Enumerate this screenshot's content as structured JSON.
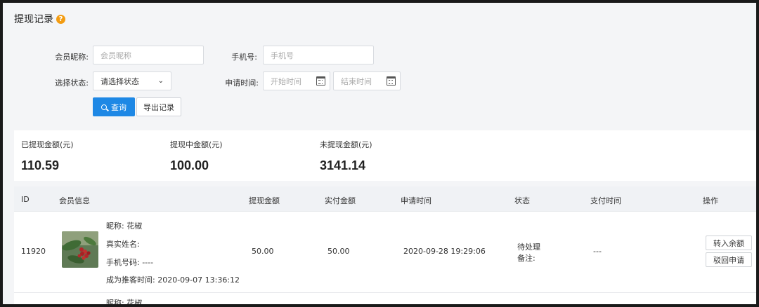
{
  "page": {
    "title": "提现记录",
    "help_glyph": "?"
  },
  "filters": {
    "member_nickname_label": "会员昵称:",
    "member_nickname_placeholder": "会员昵称",
    "phone_label": "手机号:",
    "phone_placeholder": "手机号",
    "status_label": "选择状态:",
    "status_selected": "请选择状态",
    "apply_time_label": "申请时间:",
    "start_time_placeholder": "开始时间",
    "end_time_placeholder": "结束时间",
    "search_button": "查询",
    "export_button": "导出记录"
  },
  "stats": [
    {
      "label": "已提现金额(元)",
      "value": "110.59"
    },
    {
      "label": "提现中金额(元)",
      "value": "100.00"
    },
    {
      "label": "未提现金额(元)",
      "value": "3141.14"
    }
  ],
  "table": {
    "columns": [
      "ID",
      "会员信息",
      "提现金额",
      "实付金额",
      "申请时间",
      "状态",
      "支付时间",
      "操作"
    ],
    "rows": [
      {
        "id": "11920",
        "nickname": "昵称: 花椒",
        "real_name": "真实姓名:",
        "phone": "手机号码: ----",
        "promoter_time": "成为推客时间: 2020-09-07 13:36:12",
        "amount": "50.00",
        "paid": "50.00",
        "apply_time": "2020-09-28 19:29:06",
        "status": "待处理",
        "remark": "备注:",
        "pay_time": "---",
        "actions": [
          "转入余额",
          "驳回申请"
        ]
      }
    ],
    "next_row_partial": "昵称: 花椒"
  }
}
